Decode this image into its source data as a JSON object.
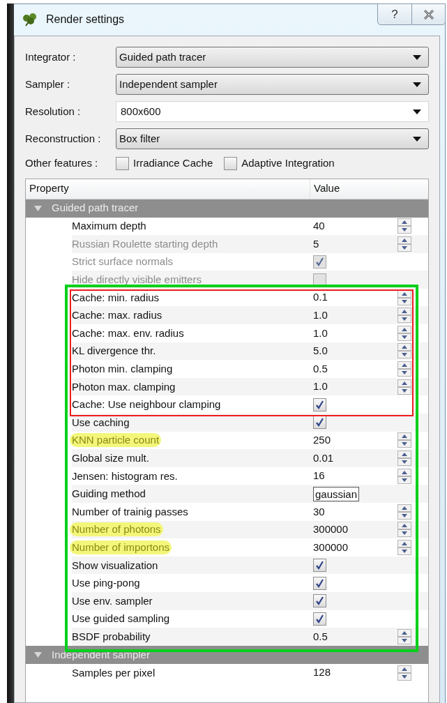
{
  "window": {
    "title": "Render settings",
    "help_button": "?"
  },
  "form": {
    "fields": [
      {
        "label": "Integrator :",
        "value": "Guided path tracer",
        "kind": "combo"
      },
      {
        "label": "Sampler :",
        "value": "Independent sampler",
        "kind": "combo"
      },
      {
        "label": "Resolution :",
        "value": "800x600",
        "kind": "editable_combo"
      },
      {
        "label": "Reconstruction :",
        "value": "Box filter",
        "kind": "combo"
      }
    ],
    "other_features": {
      "label": "Other features :",
      "options": [
        {
          "label": "Irradiance Cache",
          "checked": false
        },
        {
          "label": "Adaptive Integration",
          "checked": false
        }
      ]
    }
  },
  "table": {
    "columns": [
      "Property",
      "Value"
    ],
    "groups": [
      {
        "title": "Guided path tracer",
        "expanded": true,
        "rows": [
          {
            "label": "Maximum depth",
            "kind": "spin",
            "value": "40",
            "disabled": false,
            "highlighted": false
          },
          {
            "label": "Russian Roulette starting depth",
            "kind": "spin",
            "value": "5",
            "disabled": true,
            "highlighted": false
          },
          {
            "label": "Strict surface normals",
            "kind": "check",
            "checked": true,
            "disabled": true,
            "highlighted": false
          },
          {
            "label": "Hide directly visible emitters",
            "kind": "check",
            "checked": false,
            "disabled": true,
            "highlighted": false
          },
          {
            "kind": "annotation_box",
            "color": "#00d01a",
            "children": [
              {
                "kind": "annotation_box",
                "color": "#ee1c1c",
                "children": [
                  {
                    "label": "Cache: min. radius",
                    "kind": "spin",
                    "value": "0.1",
                    "disabled": false,
                    "highlighted": false
                  },
                  {
                    "label": "Cache: max. radius",
                    "kind": "spin",
                    "value": "1.0",
                    "disabled": false,
                    "highlighted": false
                  },
                  {
                    "label": "Cache: max. env. radius",
                    "kind": "spin",
                    "value": "1.0",
                    "disabled": false,
                    "highlighted": false
                  },
                  {
                    "label": "KL divergence thr.",
                    "kind": "spin",
                    "value": "5.0",
                    "disabled": false,
                    "highlighted": false
                  },
                  {
                    "label": "Photon min. clamping",
                    "kind": "spin",
                    "value": "0.5",
                    "disabled": false,
                    "highlighted": false
                  },
                  {
                    "label": "Photon max. clamping",
                    "kind": "spin",
                    "value": "1.0",
                    "disabled": false,
                    "highlighted": false
                  },
                  {
                    "label": "Cache: Use neighbour clamping",
                    "kind": "check",
                    "checked": true,
                    "disabled": false,
                    "highlighted": false
                  }
                ]
              },
              {
                "label": "Use caching",
                "kind": "check",
                "checked": true,
                "disabled": false,
                "highlighted": false
              },
              {
                "label": "KNN particle count",
                "kind": "spin",
                "value": "250",
                "disabled": false,
                "highlighted": true
              },
              {
                "label": "Global size mult.",
                "kind": "spin",
                "value": "0.01",
                "disabled": false,
                "highlighted": false
              },
              {
                "label": "Jensen: histogram res.",
                "kind": "spin",
                "value": "16",
                "disabled": false,
                "highlighted": false
              },
              {
                "label": "Guiding method",
                "kind": "text",
                "value": "gaussian",
                "disabled": false,
                "highlighted": false
              },
              {
                "label": "Number of trainig passes",
                "kind": "spin",
                "value": "30",
                "disabled": false,
                "highlighted": false
              },
              {
                "label": "Number of photons",
                "kind": "spin",
                "value": "300000",
                "disabled": false,
                "highlighted": true
              },
              {
                "label": "Number of importons",
                "kind": "spin",
                "value": "300000",
                "disabled": false,
                "highlighted": true
              },
              {
                "label": "Show visualization",
                "kind": "check",
                "checked": true,
                "disabled": false,
                "highlighted": false
              },
              {
                "label": "Use ping-pong",
                "kind": "check",
                "checked": true,
                "disabled": false,
                "highlighted": false
              },
              {
                "label": "Use env. sampler",
                "kind": "check",
                "checked": true,
                "disabled": false,
                "highlighted": false
              },
              {
                "label": "Use guided sampling",
                "kind": "check",
                "checked": true,
                "disabled": false,
                "highlighted": false
              },
              {
                "label": "BSDF probability",
                "kind": "spin",
                "value": "0.5",
                "disabled": false,
                "highlighted": false
              }
            ]
          }
        ]
      },
      {
        "title": "Independent sampler",
        "expanded": true,
        "rows": [
          {
            "label": "Samples per pixel",
            "kind": "spin",
            "value": "128",
            "disabled": false,
            "highlighted": false
          }
        ]
      }
    ]
  }
}
